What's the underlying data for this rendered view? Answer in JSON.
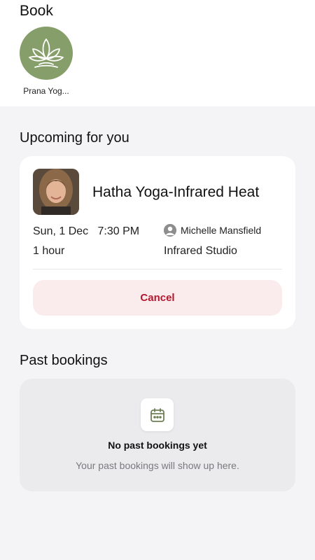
{
  "book": {
    "title": "Book",
    "studios": [
      {
        "name": "Prana Yog...",
        "logo_color": "#869e6a"
      }
    ]
  },
  "upcoming": {
    "heading": "Upcoming for you",
    "booking": {
      "class_name": "Hatha Yoga-Infrared Heat",
      "date": "Sun, 1 Dec",
      "time": "7:30 PM",
      "duration": "1 hour",
      "instructor": "Michelle Mansfield",
      "location": "Infrared Studio",
      "cancel_label": "Cancel"
    }
  },
  "past": {
    "heading": "Past bookings",
    "empty_title": "No past bookings yet",
    "empty_subtitle": "Your past bookings will show up here."
  },
  "colors": {
    "cancel_text": "#b3172f",
    "cancel_bg": "#faecec",
    "brand_green": "#869e6a"
  }
}
